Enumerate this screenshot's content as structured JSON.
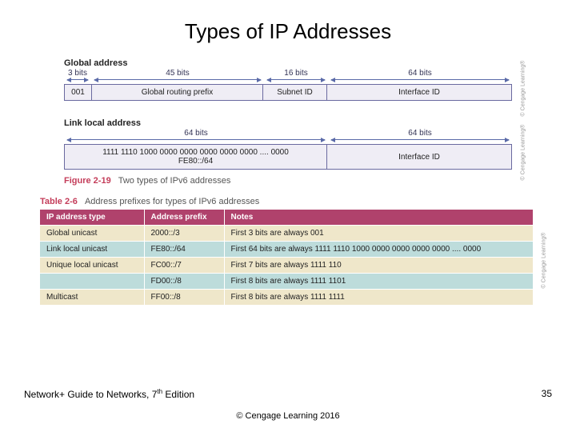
{
  "title": "Types of IP Addresses",
  "global_label": "Global address",
  "link_local_label": "Link local address",
  "global": {
    "arrows": [
      "3 bits",
      "45 bits",
      "16 bits",
      "64 bits"
    ],
    "fields": [
      "001",
      "Global routing prefix",
      "Subnet ID",
      "Interface ID"
    ]
  },
  "link_local": {
    "arrows": [
      "64 bits",
      "64 bits"
    ],
    "fields": [
      "1111 1110 1000 0000 0000 0000 0000 0000 .... 0000\nFE80::/64",
      "Interface ID"
    ]
  },
  "side_copyright": "© Cengage Learning®",
  "figure": {
    "num": "Figure 2-19",
    "text": "Two types of IPv6 addresses"
  },
  "table_caption": {
    "num": "Table 2-6",
    "text": "Address prefixes for types of IPv6 addresses"
  },
  "table": {
    "headers": [
      "IP address type",
      "Address prefix",
      "Notes"
    ],
    "rows": [
      [
        "Global unicast",
        "2000::/3",
        "First 3 bits are always 001"
      ],
      [
        "Link local unicast",
        "FE80::/64",
        "First 64 bits are always 1111 1110 1000 0000 0000 0000 0000 .... 0000"
      ],
      [
        "Unique local unicast",
        "FC00::/7",
        "First 7 bits are always 1111 110"
      ],
      [
        "",
        "FD00::/8",
        "First 8 bits are always 1111 1101"
      ],
      [
        "Multicast",
        "FF00::/8",
        "First 8 bits are always 1111 1111"
      ]
    ]
  },
  "footer": {
    "book_prefix": "Network+ Guide to Networks, 7",
    "book_suffix": " Edition",
    "th": "th",
    "copyright": "© Cengage Learning  2016",
    "page": "35"
  }
}
